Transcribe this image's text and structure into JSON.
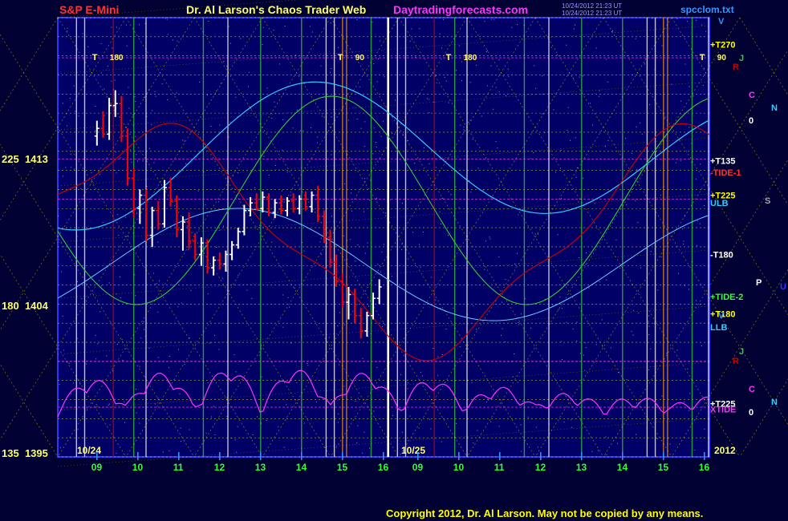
{
  "header": {
    "title_left": "S&P E-Mini",
    "title_center": "Dr. Al Larson's Chaos Trader Web",
    "title_site": "Daytradingforecasts.com",
    "timestamp_1": "10/24/2012 21:23 UT",
    "timestamp_2": "10/24/2012 21:23 UT",
    "file_name": "spcclom.txt"
  },
  "footer": {
    "copyright": "Copyright 2012, Dr. Al Larson. May not be copied by any means."
  },
  "colors": {
    "background": "#000033",
    "plot_bg": "#000066",
    "bear_bar": "#ff0000",
    "bull_bar": "#ffffff",
    "grid_yellow": "#ffff00",
    "flux_magenta": "#ff33ff",
    "flux_cyan": "#33ccff",
    "flux_green": "#33cc33",
    "flux_red": "#cc0000"
  },
  "chart_data": {
    "type": "bar",
    "y_labels": [
      {
        "angle": "225",
        "price": "1413",
        "value": 1413
      },
      {
        "angle": "180",
        "price": "1404",
        "value": 1404
      },
      {
        "angle": "135",
        "price": "1395",
        "value": 1395
      }
    ],
    "ylim": [
      1395,
      1418
    ],
    "date_labels": [
      "10/24",
      "10/25",
      "2012"
    ],
    "x_ticks": [
      "09",
      "10",
      "11",
      "12",
      "13",
      "14",
      "15",
      "16",
      "09",
      "10",
      "11",
      "12",
      "13",
      "14",
      "15",
      "16"
    ],
    "right_labels": [
      {
        "text": "+T270",
        "color": "#ffff00",
        "y": 1416.6
      },
      {
        "text": "+T135",
        "color": "#ffffff",
        "y": 1410.5
      },
      {
        "text": "-TIDE-1",
        "color": "#ff3333",
        "y": 1409.9
      },
      {
        "text": "+T225",
        "color": "#ffff00",
        "y": 1408.7
      },
      {
        "text": "ULB",
        "color": "#33ccff",
        "y": 1408.3
      },
      {
        "text": "-T180",
        "color": "#ffffff",
        "y": 1405.6
      },
      {
        "text": "+TIDE-2",
        "color": "#33ff33",
        "y": 1403.4
      },
      {
        "text": "+T180",
        "color": "#ffff00",
        "y": 1402.5
      },
      {
        "text": "LLB",
        "color": "#33ccff",
        "y": 1401.8
      },
      {
        "text": "+T225",
        "color": "#ffffff",
        "y": 1397.8
      },
      {
        "text": "XTIDE",
        "color": "#ff33ff",
        "y": 1397.5
      }
    ],
    "planet_glyphs": [
      {
        "text": "J",
        "color": "#33cc33"
      },
      {
        "text": "R",
        "color": "#cc0000"
      },
      {
        "text": "C",
        "color": "#ff33ff"
      },
      {
        "text": "N",
        "color": "#33ccff"
      },
      {
        "text": "0",
        "color": "#ffffff"
      },
      {
        "text": "S",
        "color": "#aaaaaa"
      },
      {
        "text": "P",
        "color": "#ffffff"
      },
      {
        "text": "U",
        "color": "#3333ff"
      },
      {
        "text": "J",
        "color": "#33cc33"
      },
      {
        "text": "R",
        "color": "#cc0000"
      },
      {
        "text": "C",
        "color": "#ff33ff"
      },
      {
        "text": "N",
        "color": "#33ccff"
      },
      {
        "text": "0",
        "color": "#ffffff"
      },
      {
        "text": "V",
        "color": "#3399ff"
      },
      {
        "text": "V",
        "color": "#3399ff"
      }
    ],
    "top_markers": [
      {
        "text": "T",
        "sub": "180",
        "day": 0,
        "hour": 9.0
      },
      {
        "text": "T",
        "sub": "90",
        "day": 0,
        "hour": 15.0
      },
      {
        "text": "T",
        "sub": "180",
        "day": 1,
        "hour": 9.8
      },
      {
        "text": "T",
        "sub": "90",
        "day": 1,
        "hour": 16.0
      }
    ],
    "ohlc": [
      {
        "h": 9.0,
        "o": 1411.8,
        "hi": 1412.6,
        "lo": 1411.3,
        "c": 1412.2
      },
      {
        "h": 9.15,
        "o": 1412.2,
        "hi": 1413.1,
        "lo": 1411.7,
        "c": 1411.9
      },
      {
        "h": 9.3,
        "o": 1411.9,
        "hi": 1413.8,
        "lo": 1411.6,
        "c": 1413.4
      },
      {
        "h": 9.45,
        "o": 1413.4,
        "hi": 1414.2,
        "lo": 1412.8,
        "c": 1413.5
      },
      {
        "h": 9.6,
        "o": 1413.5,
        "hi": 1413.9,
        "lo": 1411.5,
        "c": 1411.8
      },
      {
        "h": 9.75,
        "o": 1411.8,
        "hi": 1412.2,
        "lo": 1409.2,
        "c": 1409.6
      },
      {
        "h": 9.9,
        "o": 1409.6,
        "hi": 1410.1,
        "lo": 1407.5,
        "c": 1408.0
      },
      {
        "h": 10.05,
        "o": 1408.0,
        "hi": 1409.0,
        "lo": 1407.2,
        "c": 1408.7
      },
      {
        "h": 10.2,
        "o": 1408.7,
        "hi": 1409.0,
        "lo": 1406.3,
        "c": 1406.6
      },
      {
        "h": 10.35,
        "o": 1406.6,
        "hi": 1408.1,
        "lo": 1406.0,
        "c": 1407.9
      },
      {
        "h": 10.5,
        "o": 1407.9,
        "hi": 1408.4,
        "lo": 1406.9,
        "c": 1407.2
      },
      {
        "h": 10.65,
        "o": 1407.2,
        "hi": 1409.5,
        "lo": 1407.0,
        "c": 1409.1
      },
      {
        "h": 10.8,
        "o": 1409.1,
        "hi": 1409.6,
        "lo": 1408.1,
        "c": 1408.4
      },
      {
        "h": 10.95,
        "o": 1408.4,
        "hi": 1408.7,
        "lo": 1406.5,
        "c": 1406.9
      },
      {
        "h": 11.1,
        "o": 1406.9,
        "hi": 1407.6,
        "lo": 1405.8,
        "c": 1407.3
      },
      {
        "h": 11.25,
        "o": 1407.3,
        "hi": 1407.8,
        "lo": 1405.9,
        "c": 1406.3
      },
      {
        "h": 11.4,
        "o": 1406.3,
        "hi": 1406.7,
        "lo": 1405.3,
        "c": 1405.6
      },
      {
        "h": 11.55,
        "o": 1405.6,
        "hi": 1406.5,
        "lo": 1405.0,
        "c": 1406.2
      },
      {
        "h": 11.7,
        "o": 1406.2,
        "hi": 1406.4,
        "lo": 1404.6,
        "c": 1404.9
      },
      {
        "h": 11.85,
        "o": 1404.9,
        "hi": 1405.5,
        "lo": 1404.5,
        "c": 1405.3
      },
      {
        "h": 12.0,
        "o": 1405.3,
        "hi": 1405.7,
        "lo": 1404.8,
        "c": 1405.1
      },
      {
        "h": 12.15,
        "o": 1405.1,
        "hi": 1405.8,
        "lo": 1404.7,
        "c": 1405.6
      },
      {
        "h": 12.3,
        "o": 1405.6,
        "hi": 1406.3,
        "lo": 1405.3,
        "c": 1406.1
      },
      {
        "h": 12.45,
        "o": 1406.1,
        "hi": 1407.0,
        "lo": 1405.9,
        "c": 1406.8
      },
      {
        "h": 12.6,
        "o": 1406.8,
        "hi": 1408.2,
        "lo": 1406.6,
        "c": 1407.9
      },
      {
        "h": 12.75,
        "o": 1407.9,
        "hi": 1408.6,
        "lo": 1407.6,
        "c": 1408.3
      },
      {
        "h": 12.9,
        "o": 1408.3,
        "hi": 1408.8,
        "lo": 1407.9,
        "c": 1408.0
      },
      {
        "h": 13.05,
        "o": 1408.0,
        "hi": 1408.9,
        "lo": 1407.8,
        "c": 1408.6
      },
      {
        "h": 13.2,
        "o": 1408.6,
        "hi": 1408.8,
        "lo": 1407.6,
        "c": 1407.8
      },
      {
        "h": 13.35,
        "o": 1407.8,
        "hi": 1408.5,
        "lo": 1407.5,
        "c": 1408.3
      },
      {
        "h": 13.5,
        "o": 1408.3,
        "hi": 1408.7,
        "lo": 1407.7,
        "c": 1407.9
      },
      {
        "h": 13.65,
        "o": 1407.9,
        "hi": 1408.6,
        "lo": 1407.6,
        "c": 1408.4
      },
      {
        "h": 13.8,
        "o": 1408.4,
        "hi": 1408.8,
        "lo": 1407.8,
        "c": 1408.0
      },
      {
        "h": 13.95,
        "o": 1408.0,
        "hi": 1408.7,
        "lo": 1407.7,
        "c": 1408.5
      },
      {
        "h": 14.1,
        "o": 1408.5,
        "hi": 1408.9,
        "lo": 1407.9,
        "c": 1408.1
      },
      {
        "h": 14.25,
        "o": 1408.1,
        "hi": 1408.9,
        "lo": 1407.8,
        "c": 1408.7
      },
      {
        "h": 14.4,
        "o": 1408.7,
        "hi": 1409.2,
        "lo": 1407.3,
        "c": 1407.6
      },
      {
        "h": 14.55,
        "o": 1407.6,
        "hi": 1407.9,
        "lo": 1406.2,
        "c": 1406.5
      },
      {
        "h": 14.7,
        "o": 1406.5,
        "hi": 1406.9,
        "lo": 1404.9,
        "c": 1405.2
      },
      {
        "h": 14.85,
        "o": 1405.2,
        "hi": 1405.6,
        "lo": 1403.9,
        "c": 1404.2
      },
      {
        "h": 15.0,
        "o": 1404.2,
        "hi": 1404.6,
        "lo": 1402.8,
        "c": 1403.1
      },
      {
        "h": 15.15,
        "o": 1403.1,
        "hi": 1403.9,
        "lo": 1402.2,
        "c": 1403.5
      },
      {
        "h": 15.3,
        "o": 1403.5,
        "hi": 1403.8,
        "lo": 1402.0,
        "c": 1402.4
      },
      {
        "h": 15.45,
        "o": 1402.4,
        "hi": 1402.8,
        "lo": 1401.2,
        "c": 1401.6
      },
      {
        "h": 15.6,
        "o": 1401.6,
        "hi": 1402.6,
        "lo": 1401.3,
        "c": 1402.4
      },
      {
        "h": 15.75,
        "o": 1402.4,
        "hi": 1403.6,
        "lo": 1402.2,
        "c": 1403.3
      },
      {
        "h": 15.9,
        "o": 1403.3,
        "hi": 1404.3,
        "lo": 1403.0,
        "c": 1403.9
      }
    ]
  }
}
